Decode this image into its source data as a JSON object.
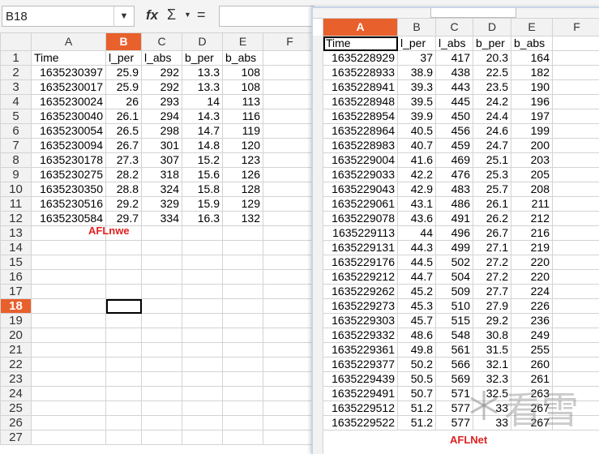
{
  "formula_bar": {
    "cell_ref": "B18",
    "fx": "fx",
    "sigma": "Σ",
    "equals": "=",
    "formula": ""
  },
  "sheet1": {
    "columns": [
      "A",
      "B",
      "C",
      "D",
      "E",
      "F"
    ],
    "selected_col": "B",
    "selected_row": "18",
    "rows": [
      [
        "1",
        "Time",
        "l_per",
        "l_abs",
        "b_per",
        "b_abs"
      ],
      [
        "2",
        "1635230397",
        "25.9",
        "292",
        "13.3",
        "108"
      ],
      [
        "3",
        "1635230017",
        "25.9",
        "292",
        "13.3",
        "108"
      ],
      [
        "4",
        "1635230024",
        "26",
        "293",
        "14",
        "113"
      ],
      [
        "5",
        "1635230040",
        "26.1",
        "294",
        "14.3",
        "116"
      ],
      [
        "6",
        "1635230054",
        "26.5",
        "298",
        "14.7",
        "119"
      ],
      [
        "7",
        "1635230094",
        "26.7",
        "301",
        "14.8",
        "120"
      ],
      [
        "8",
        "1635230178",
        "27.3",
        "307",
        "15.2",
        "123"
      ],
      [
        "9",
        "1635230275",
        "28.2",
        "318",
        "15.6",
        "126"
      ],
      [
        "10",
        "1635230350",
        "28.8",
        "324",
        "15.8",
        "128"
      ],
      [
        "11",
        "1635230516",
        "29.2",
        "329",
        "15.9",
        "129"
      ],
      [
        "12",
        "1635230584",
        "29.7",
        "334",
        "16.3",
        "132"
      ],
      [
        "13",
        "",
        "",
        "",
        "",
        ""
      ],
      [
        "14",
        "",
        "",
        "",
        "",
        ""
      ],
      [
        "15",
        "",
        "",
        "",
        "",
        ""
      ],
      [
        "16",
        "",
        "",
        "",
        "",
        ""
      ],
      [
        "17",
        "",
        "",
        "",
        "",
        ""
      ],
      [
        "18",
        "",
        "",
        "",
        "",
        ""
      ],
      [
        "19",
        "",
        "",
        "",
        "",
        ""
      ],
      [
        "20",
        "",
        "",
        "",
        "",
        ""
      ],
      [
        "21",
        "",
        "",
        "",
        "",
        ""
      ],
      [
        "22",
        "",
        "",
        "",
        "",
        ""
      ],
      [
        "23",
        "",
        "",
        "",
        "",
        ""
      ],
      [
        "24",
        "",
        "",
        "",
        "",
        ""
      ],
      [
        "25",
        "",
        "",
        "",
        "",
        ""
      ],
      [
        "26",
        "",
        "",
        "",
        "",
        ""
      ],
      [
        "27",
        "",
        "",
        "",
        "",
        ""
      ]
    ],
    "annotation": "AFLnwe"
  },
  "sheet2": {
    "columns": [
      "A",
      "B",
      "C",
      "D",
      "E",
      "F"
    ],
    "selected_col": "A",
    "rows": [
      [
        "Time",
        "l_per",
        "l_abs",
        "b_per",
        "b_abs"
      ],
      [
        "1635228929",
        "37",
        "417",
        "20.3",
        "164"
      ],
      [
        "1635228933",
        "38.9",
        "438",
        "22.5",
        "182"
      ],
      [
        "1635228941",
        "39.3",
        "443",
        "23.5",
        "190"
      ],
      [
        "1635228948",
        "39.5",
        "445",
        "24.2",
        "196"
      ],
      [
        "1635228954",
        "39.9",
        "450",
        "24.4",
        "197"
      ],
      [
        "1635228964",
        "40.5",
        "456",
        "24.6",
        "199"
      ],
      [
        "1635228983",
        "40.7",
        "459",
        "24.7",
        "200"
      ],
      [
        "1635229004",
        "41.6",
        "469",
        "25.1",
        "203"
      ],
      [
        "1635229033",
        "42.2",
        "476",
        "25.3",
        "205"
      ],
      [
        "1635229043",
        "42.9",
        "483",
        "25.7",
        "208"
      ],
      [
        "1635229061",
        "43.1",
        "486",
        "26.1",
        "211"
      ],
      [
        "1635229078",
        "43.6",
        "491",
        "26.2",
        "212"
      ],
      [
        "1635229113",
        "44",
        "496",
        "26.7",
        "216"
      ],
      [
        "1635229131",
        "44.3",
        "499",
        "27.1",
        "219"
      ],
      [
        "1635229176",
        "44.5",
        "502",
        "27.2",
        "220"
      ],
      [
        "1635229212",
        "44.7",
        "504",
        "27.2",
        "220"
      ],
      [
        "1635229262",
        "45.2",
        "509",
        "27.7",
        "224"
      ],
      [
        "1635229273",
        "45.3",
        "510",
        "27.9",
        "226"
      ],
      [
        "1635229303",
        "45.7",
        "515",
        "29.2",
        "236"
      ],
      [
        "1635229332",
        "48.6",
        "548",
        "30.8",
        "249"
      ],
      [
        "1635229361",
        "49.8",
        "561",
        "31.5",
        "255"
      ],
      [
        "1635229377",
        "50.2",
        "566",
        "32.1",
        "260"
      ],
      [
        "1635229439",
        "50.5",
        "569",
        "32.3",
        "261"
      ],
      [
        "1635229491",
        "50.7",
        "571",
        "32.5",
        "263"
      ],
      [
        "1635229512",
        "51.2",
        "577",
        "33",
        "267"
      ],
      [
        "1635229522",
        "51.2",
        "577",
        "33",
        "267"
      ]
    ],
    "annotation": "AFLNet"
  },
  "watermark": "看雪"
}
